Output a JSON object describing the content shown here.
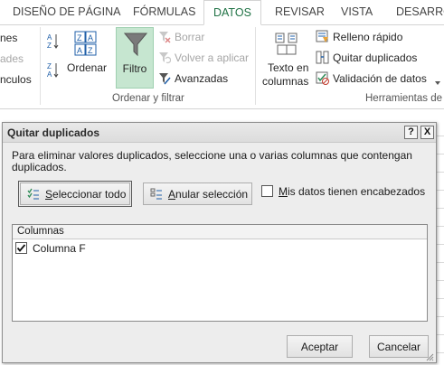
{
  "ribbon": {
    "tabs": [
      "DISEÑO DE PÁGINA",
      "FÓRMULAS",
      "DATOS",
      "REVISAR",
      "VISTA",
      "DESARROL"
    ],
    "active_tab": "DATOS",
    "left_partial": [
      "nes",
      "ades",
      "nculos"
    ],
    "sort_label": "Ordenar",
    "filter_label": "Filtro",
    "clear_label": "Borrar",
    "reapply_label": "Volver a aplicar",
    "advanced_label": "Avanzadas",
    "sort_filter_group": "Ordenar y filtrar",
    "text_to_columns": [
      "Texto en",
      "columnas"
    ],
    "flash_fill": "Relleno rápido",
    "remove_duplicates": "Quitar duplicados",
    "data_validation": "Validación de datos",
    "data_tools_group": "Herramientas de",
    "accent_color": "#217346",
    "filter_active_bg": "#c6e6d0"
  },
  "dialog": {
    "title": "Quitar duplicados",
    "help_glyph": "?",
    "close_glyph": "X",
    "description": "Para eliminar valores duplicados, seleccione una o varias columnas que contengan duplicados.",
    "select_all": {
      "mnemonic": "S",
      "rest": "eleccionar todo"
    },
    "unselect_all": {
      "mnemonic": "A",
      "rest": "nular selección"
    },
    "headers_checkbox": {
      "mnemonic": "M",
      "rest": "is datos tienen encabezados",
      "checked": false
    },
    "list_header": "Columnas",
    "columns": [
      {
        "label": "Columna F",
        "checked": true
      }
    ],
    "ok_label": "Aceptar",
    "cancel_label": "Cancelar"
  }
}
